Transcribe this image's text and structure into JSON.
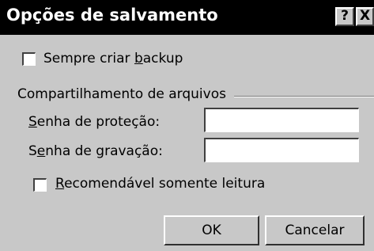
{
  "dialog": {
    "title": "Opções de salvamento",
    "help_label": "?",
    "close_label": "X"
  },
  "backup": {
    "label_pre": "Sempre criar ",
    "label_key": "b",
    "label_post": "ackup",
    "checked": false
  },
  "sharing": {
    "group_label": "Compartilhamento de arquivos",
    "protect_label_key": "S",
    "protect_label_post": "enha de proteção:",
    "protect_value": "",
    "write_label_pre": "S",
    "write_label_key": "e",
    "write_label_post": "nha de gravação:",
    "write_value": "",
    "readonly_label_key": "R",
    "readonly_label_post": "ecomendável somente leitura",
    "readonly_checked": false
  },
  "buttons": {
    "ok_label": "OK",
    "cancel_label": "Cancelar"
  }
}
